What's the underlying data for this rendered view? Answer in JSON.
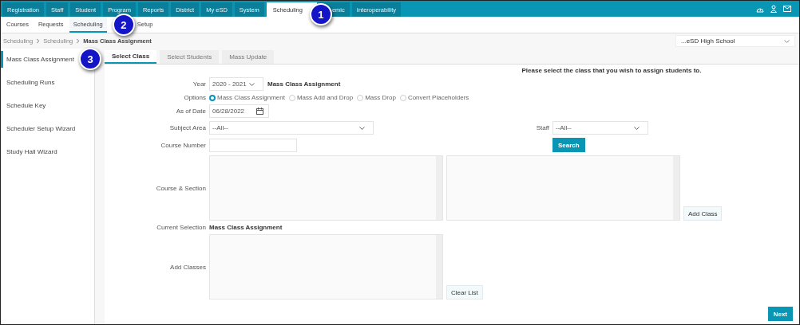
{
  "top_nav": [
    {
      "label": "Registration",
      "selected": false
    },
    {
      "label": "Staff",
      "selected": false
    },
    {
      "label": "Student",
      "selected": false
    },
    {
      "label": "Program",
      "selected": false
    },
    {
      "label": "Reports",
      "selected": false
    },
    {
      "label": "District",
      "selected": false
    },
    {
      "label": "My eSD",
      "selected": false
    },
    {
      "label": "System",
      "selected": false
    },
    {
      "label": "Scheduling",
      "selected": true
    },
    {
      "label": "emic",
      "selected": false
    },
    {
      "label": "Interoperability",
      "selected": false
    }
  ],
  "sub_nav": [
    {
      "label": "Courses",
      "selected": false
    },
    {
      "label": "Requests",
      "selected": false
    },
    {
      "label": "Scheduling",
      "selected": true
    },
    {
      "label": "Setup",
      "selected": false
    }
  ],
  "breadcrumb": [
    "Scheduling",
    "Scheduling",
    "Mass Class Assignment"
  ],
  "school_select": {
    "value": "...eSD High School"
  },
  "sidebar": {
    "items": [
      {
        "label": "Mass Class Assignment",
        "selected": true
      },
      {
        "label": "Scheduling Runs",
        "selected": false
      },
      {
        "label": "Schedule Key",
        "selected": false
      },
      {
        "label": "Scheduler Setup Wizard",
        "selected": false
      },
      {
        "label": "Study Hall Wizard",
        "selected": false
      }
    ]
  },
  "tabs": [
    {
      "label": "Select Class",
      "selected": true
    },
    {
      "label": "Select Students",
      "selected": false
    },
    {
      "label": "Mass Update",
      "selected": false
    }
  ],
  "instruction": "Please select the class that you wish to assign students to.",
  "form": {
    "year": {
      "label": "Year",
      "value": "2020 - 2021",
      "note": "Mass Class Assignment"
    },
    "options": {
      "label": "Options",
      "items": [
        {
          "label": "Mass Class Assignment",
          "selected": true
        },
        {
          "label": "Mass Add and Drop",
          "selected": false
        },
        {
          "label": "Mass Drop",
          "selected": false
        },
        {
          "label": "Convert Placeholders",
          "selected": false
        }
      ]
    },
    "as_of_date": {
      "label": "As of Date",
      "value": "06/28/2022"
    },
    "subject_area": {
      "label": "Subject Area",
      "value": "--All--"
    },
    "staff": {
      "label": "Staff",
      "value": "--All--"
    },
    "course_number": {
      "label": "Course Number"
    },
    "search_button": "Search",
    "course_section": {
      "label": "Course & Section"
    },
    "add_class_button": "Add Class",
    "current_selection": {
      "label": "Current Selection",
      "value": "Mass Class Assignment"
    },
    "add_classes": {
      "label": "Add Classes"
    },
    "clear_list_button": "Clear List"
  },
  "next_button": "Next",
  "callouts": [
    "1",
    "2",
    "3"
  ]
}
